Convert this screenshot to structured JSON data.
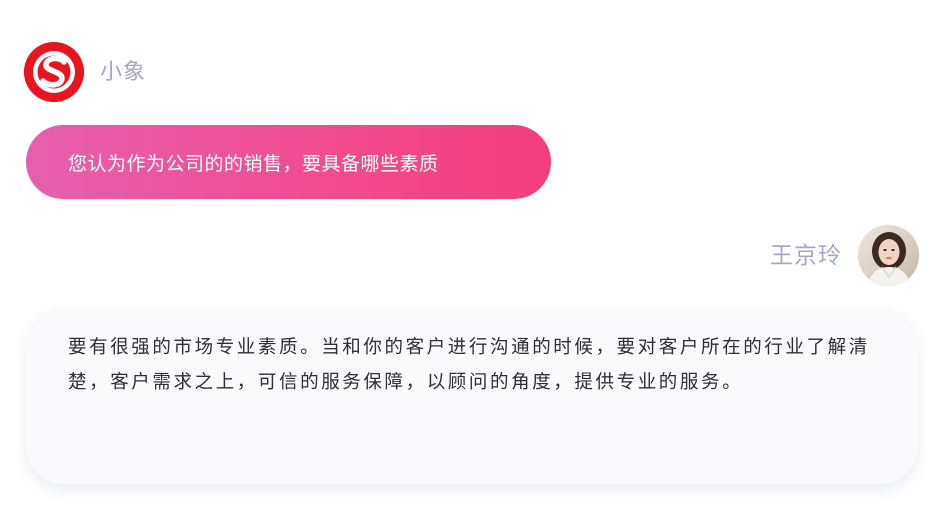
{
  "bot": {
    "name": "小象",
    "avatar_icon": "red-s-logo-icon",
    "brand_color": "#e8141f",
    "message": "您认为作为公司的的销售，要具备哪些素质",
    "bubble_gradient": [
      "#e65fae",
      "#f43d7c"
    ]
  },
  "user": {
    "name": "王京玲",
    "avatar_icon": "user-photo-avatar",
    "message": "要有很强的市场专业素质。当和你的客户进行沟通的时候，要对客户所在的行业了解清楚，客户需求之上，可信的服务保障，以顾问的角度，提供专业的服务。"
  },
  "colors": {
    "name_text": "#a4a8c4",
    "body_text": "#2e2e33",
    "answer_bubble": "#fafafd"
  }
}
